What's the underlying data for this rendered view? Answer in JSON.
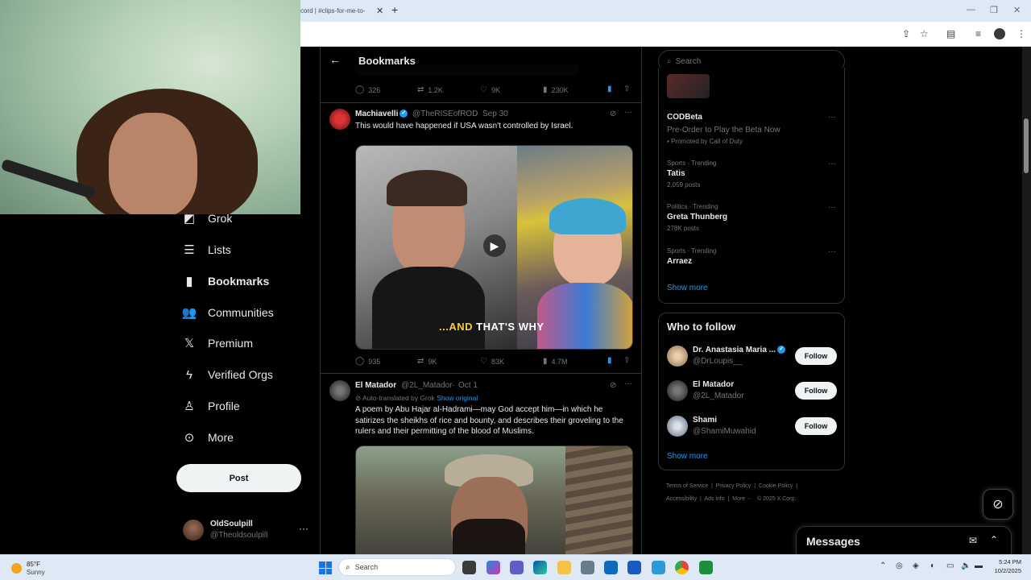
{
  "browser": {
    "tab_title": "cord | #clips-for-me-to-",
    "new_tab_icon": "plus-icon",
    "close_tab_icon": "close-icon"
  },
  "nav": {
    "items": [
      {
        "label": "Grok",
        "icon": "grok-icon"
      },
      {
        "label": "Lists",
        "icon": "lists-icon"
      },
      {
        "label": "Bookmarks",
        "icon": "bookmark-icon",
        "active": true
      },
      {
        "label": "Communities",
        "icon": "communities-icon"
      },
      {
        "label": "Premium",
        "icon": "x-logo-icon"
      },
      {
        "label": "Verified Orgs",
        "icon": "lightning-icon"
      },
      {
        "label": "Profile",
        "icon": "person-icon"
      },
      {
        "label": "More",
        "icon": "more-circle-icon"
      }
    ],
    "post_label": "Post",
    "account": {
      "name": "OldSoulpill",
      "handle": "@Theoldsoulpill"
    }
  },
  "main": {
    "title": "Bookmarks",
    "top_actions": {
      "replies": "326",
      "reposts": "1.2K",
      "likes": "9K",
      "views": "230K"
    },
    "tweets": [
      {
        "name": "Machiavelli",
        "handle": "@TheRISEofROD",
        "date": "Sep 30",
        "text": "This would have happened if USA wasn't controlled by Israel.",
        "video_caption_a": "...AND",
        "video_caption_b": "THAT'S WHY",
        "actions": {
          "replies": "935",
          "reposts": "9K",
          "likes": "83K",
          "views": "4.7M"
        }
      },
      {
        "name": "El Matador",
        "handle": "@2L_Matador",
        "date": "Oct 1",
        "translated_note": "Auto-translated by Grok",
        "show_original": "Show original",
        "text": "A poem by Abu Hajar al-Hadrami—may God accept him—in which he satirizes the sheikhs of rice and bounty, and describes their groveling to the rulers and their permitting of the blood of Muslims."
      }
    ]
  },
  "right": {
    "search_placeholder": "Search",
    "promoted": {
      "title": "CODBeta",
      "subtitle": "Pre-Order to Play the Beta Now",
      "promoted_by": "Promoted by Call of Duty"
    },
    "trends": [
      {
        "category": "Sports · Trending",
        "topic": "Tatis",
        "posts": "2,059 posts"
      },
      {
        "category": "Politics · Trending",
        "topic": "Greta Thunberg",
        "posts": "278K posts"
      },
      {
        "category": "Sports · Trending",
        "topic": "Arraez",
        "posts": ""
      }
    ],
    "show_more": "Show more",
    "who_to_follow": {
      "title": "Who to follow",
      "follow_label": "Follow",
      "accounts": [
        {
          "name": "Dr. Anastasia Maria ...",
          "handle": "@DrLoupis__",
          "verified": true
        },
        {
          "name": "El Matador",
          "handle": "@2L_Matador",
          "verified": false
        },
        {
          "name": "Shami",
          "handle": "@ShamiMuwahid",
          "verified": false
        }
      ]
    },
    "footer": {
      "line1": [
        "Terms of Service",
        "Privacy Policy",
        "Cookie Policy"
      ],
      "line2": [
        "Accessibility",
        "Ads info",
        "More ···",
        "© 2025 X Corp."
      ]
    }
  },
  "messages": {
    "title": "Messages"
  },
  "taskbar": {
    "temp": "85°F",
    "condition": "Sunny",
    "search_placeholder": "Search",
    "time": "5:24 PM",
    "date": "10/2/2025"
  },
  "colors": {
    "accent": "#1d9bf0",
    "background": "#000000",
    "border": "#2f3336",
    "muted": "#71767b"
  }
}
